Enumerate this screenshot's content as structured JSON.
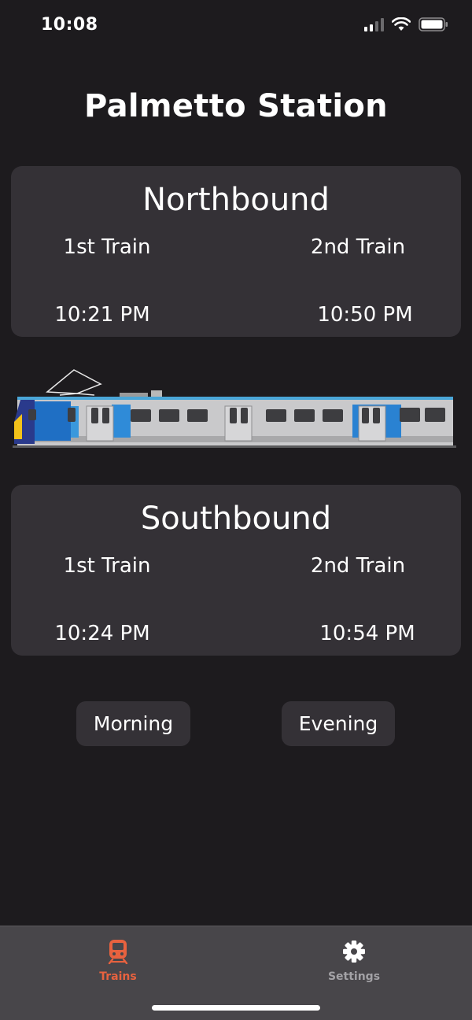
{
  "status_bar": {
    "time": "10:08"
  },
  "page_title": "Palmetto Station",
  "northbound": {
    "title": "Northbound",
    "first_label": "1st Train",
    "second_label": "2nd Train",
    "first_time": "10:21 PM",
    "second_time": "10:50 PM"
  },
  "southbound": {
    "title": "Southbound",
    "first_label": "1st Train",
    "second_label": "2nd Train",
    "first_time": "10:24 PM",
    "second_time": "10:54 PM"
  },
  "buttons": {
    "morning": "Morning",
    "evening": "Evening"
  },
  "tabs": [
    {
      "label": "Trains",
      "icon": "train-icon",
      "active": true
    },
    {
      "label": "Settings",
      "icon": "gear-icon",
      "active": false
    }
  ],
  "colors": {
    "background": "#1d1b1e",
    "card": "#343136",
    "active_tab": "#e8623f",
    "tab_bar": "#48464a"
  }
}
